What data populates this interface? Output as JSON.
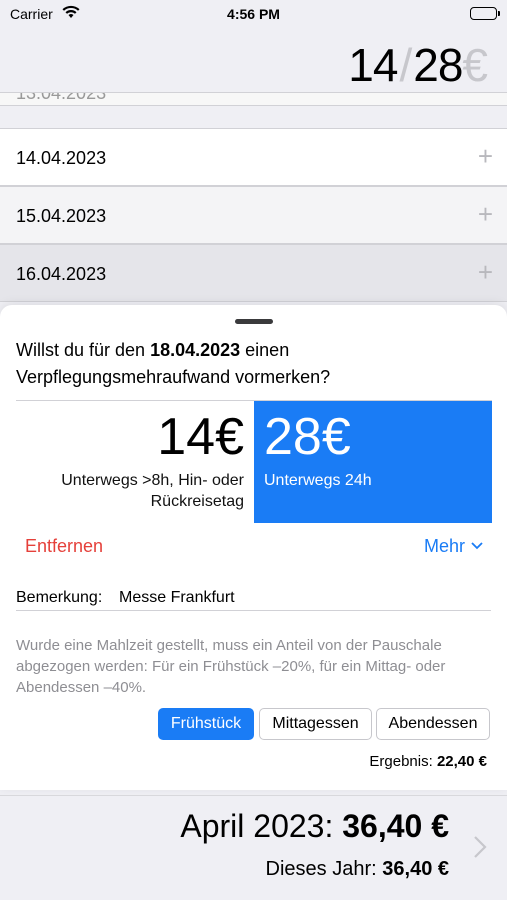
{
  "status": {
    "carrier": "Carrier",
    "time": "4:56 PM"
  },
  "header": {
    "amount_a": "14",
    "separator": "/",
    "amount_b": "28",
    "currency": "€"
  },
  "list": {
    "partial_date": "13.04.2023",
    "rows": [
      {
        "date": "14.04.2023",
        "action": "+"
      },
      {
        "date": "15.04.2023",
        "action": "+"
      },
      {
        "date": "16.04.2023",
        "action": "+"
      }
    ]
  },
  "sheet": {
    "question_prefix": "Willst du für den ",
    "question_date": "18.04.2023",
    "question_suffix": " einen Verpflegungsmehraufwand vormerken?",
    "option_a": {
      "amount": "14€",
      "desc": "Unterwegs >8h, Hin- oder Rückreisetag"
    },
    "option_b": {
      "amount": "28€",
      "desc": "Unterwegs 24h"
    },
    "remove_label": "Entfernen",
    "more_label": "Mehr",
    "remark_label": "Bemerkung:",
    "remark_value": "Messe Frankfurt",
    "hint": "Wurde eine Mahlzeit gestellt, muss ein Anteil von der Pauschale abgezogen werden: Für ein Frühstück –20%, für ein Mittag- oder Abendessen –40%.",
    "meals": {
      "breakfast": "Frühstück",
      "lunch": "Mittagessen",
      "dinner": "Abendessen"
    },
    "result_label": "Ergebnis:",
    "result_value": "22,40 €"
  },
  "summary": {
    "month_label": "April 2023:",
    "month_value": "36,40 €",
    "year_label": "Dieses Jahr:",
    "year_value": "36,40 €"
  },
  "colors": {
    "accent": "#1a7cf5",
    "destructive": "#e5403a"
  }
}
